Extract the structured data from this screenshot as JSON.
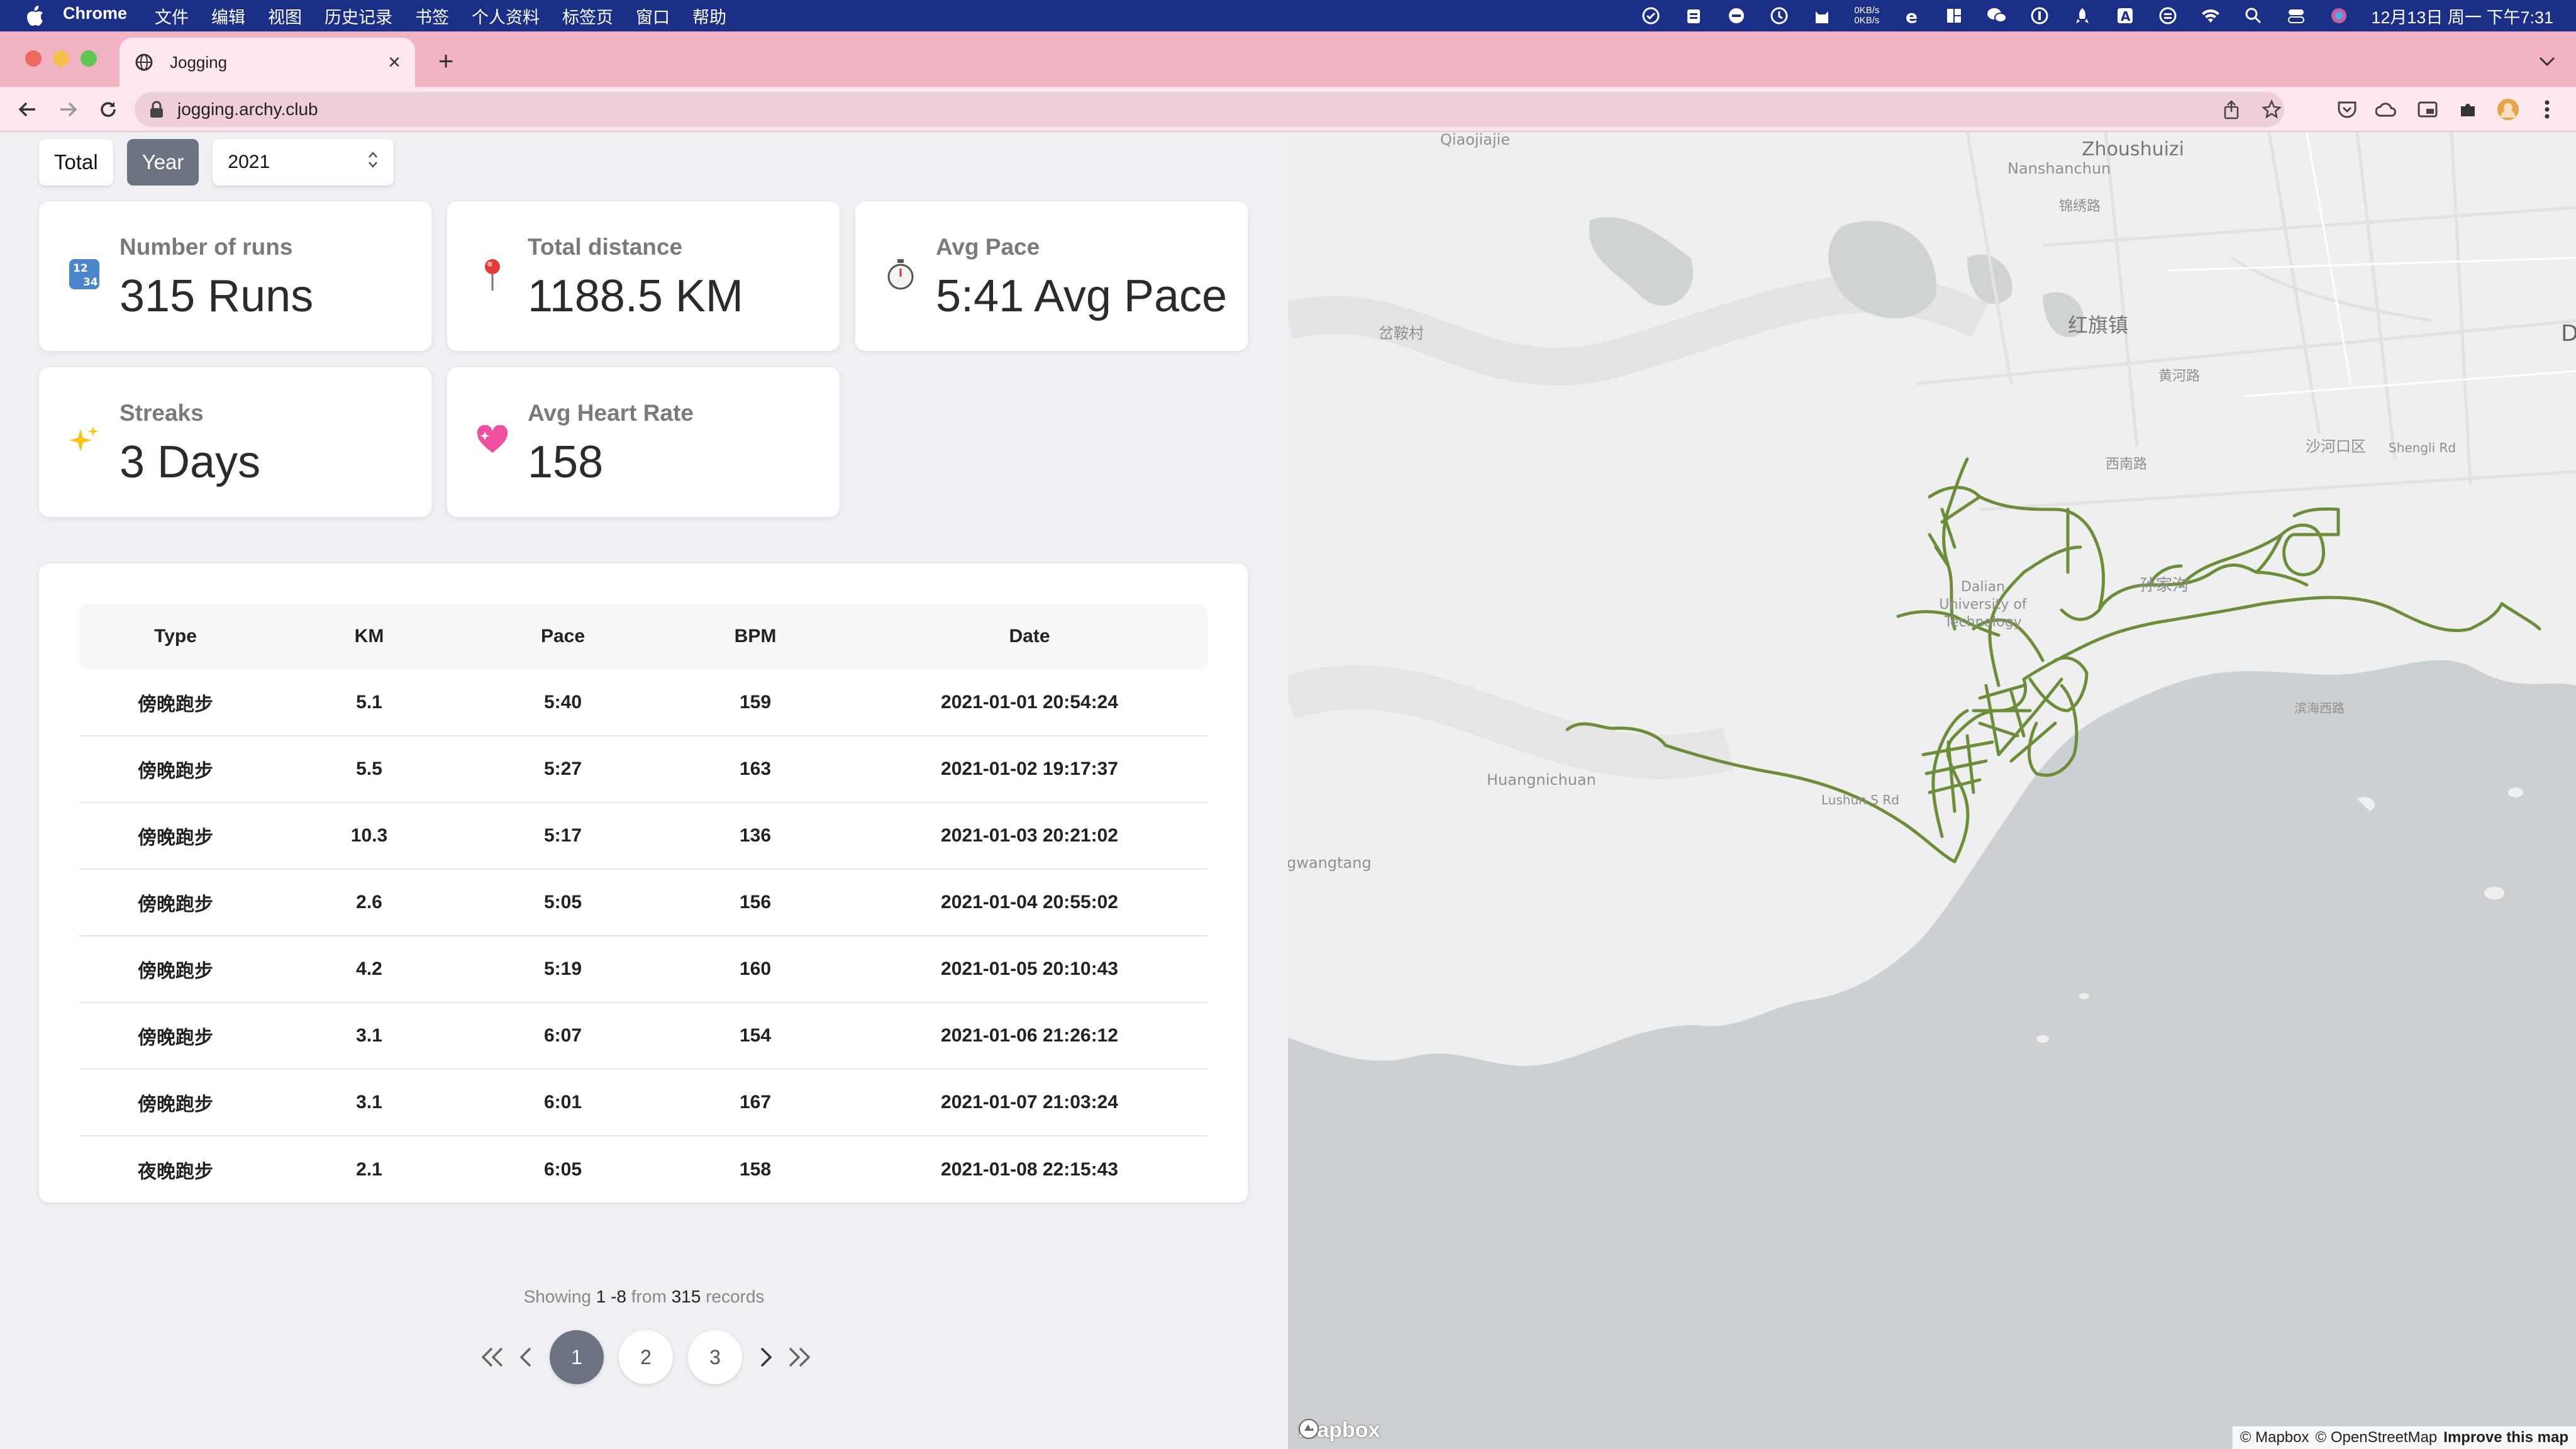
{
  "menubar": {
    "app_name": "Chrome",
    "items": [
      "文件",
      "编辑",
      "视图",
      "历史记录",
      "书签",
      "个人资料",
      "标签页",
      "窗口",
      "帮助"
    ],
    "net_up": "0KB/s",
    "net_down": "0KB/s",
    "clock": "12月13日 周一 下午7:31"
  },
  "browser": {
    "tab_title": "Jogging",
    "url": "jogging.archy.club"
  },
  "filters": {
    "total_label": "Total",
    "year_label": "Year",
    "selected_year": "2021"
  },
  "stats": [
    {
      "emoji": "🔢",
      "label": "Number of runs",
      "value": "315 Runs"
    },
    {
      "emoji": "📍",
      "label": "Total distance",
      "value": "1188.5 KM"
    },
    {
      "emoji": "⏱",
      "label": "Avg Pace",
      "value": "5:41 Avg Pace"
    },
    {
      "emoji": "✨",
      "label": "Streaks",
      "value": "3 Days"
    },
    {
      "emoji": "💖",
      "label": "Avg Heart Rate",
      "value": "158"
    }
  ],
  "table": {
    "headers": [
      "Type",
      "KM",
      "Pace",
      "BPM",
      "Date"
    ],
    "rows": [
      [
        "傍晚跑步",
        "5.1",
        "5:40",
        "159",
        "2021-01-01 20:54:24"
      ],
      [
        "傍晚跑步",
        "5.5",
        "5:27",
        "163",
        "2021-01-02 19:17:37"
      ],
      [
        "傍晚跑步",
        "10.3",
        "5:17",
        "136",
        "2021-01-03 20:21:02"
      ],
      [
        "傍晚跑步",
        "2.6",
        "5:05",
        "156",
        "2021-01-04 20:55:02"
      ],
      [
        "傍晚跑步",
        "4.2",
        "5:19",
        "160",
        "2021-01-05 20:10:43"
      ],
      [
        "傍晚跑步",
        "3.1",
        "6:07",
        "154",
        "2021-01-06 21:26:12"
      ],
      [
        "傍晚跑步",
        "3.1",
        "6:01",
        "167",
        "2021-01-07 21:03:24"
      ],
      [
        "夜晚跑步",
        "2.1",
        "6:05",
        "158",
        "2021-01-08 22:15:43"
      ]
    ]
  },
  "pagination": {
    "showing_word": "Showing",
    "range": "1 -8",
    "from_word": "from",
    "total": "315",
    "records_word": "records",
    "pages": [
      "1",
      "2",
      "3"
    ],
    "current_page": "1"
  },
  "map": {
    "labels": [
      {
        "text": "Qiaojiajie"
      },
      {
        "text": "Zhoushuizi"
      },
      {
        "text": "Nanshanchun"
      },
      {
        "text": "锦绣路"
      },
      {
        "text": "红旗镇"
      },
      {
        "text": "岔鞍村"
      },
      {
        "text": "黄河路"
      },
      {
        "text": "西南路"
      },
      {
        "text": "沙河口区"
      },
      {
        "text": "Shengli Rd"
      },
      {
        "text": "Dalian University of Technology"
      },
      {
        "text": "孙家沟"
      },
      {
        "text": "Huangnichuan"
      },
      {
        "text": "gwangtang"
      },
      {
        "text": "Lushun S Rd"
      },
      {
        "text": "滨海西路"
      },
      {
        "text": "D"
      }
    ],
    "logo": "mapbox",
    "attribution_mapbox": "© Mapbox",
    "attribution_osm": "© OpenStreetMap",
    "improve": "Improve this map",
    "route_color": "#6b8e3a"
  }
}
